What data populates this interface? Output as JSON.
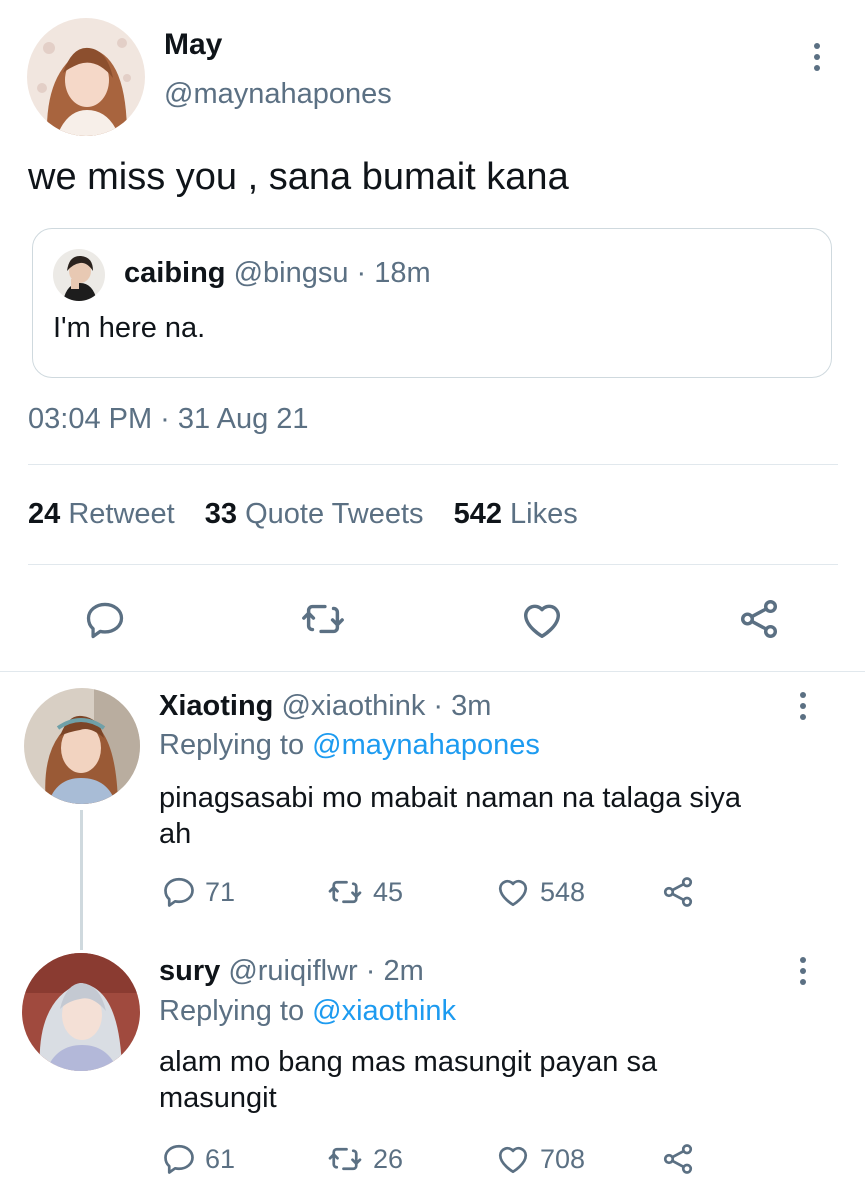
{
  "main_tweet": {
    "author_name": "May",
    "author_handle": "@maynahapones",
    "text": "we miss you , sana bumait kana",
    "quoted": {
      "author_name": "caibing",
      "meta": "@bingsu · 18m",
      "text": "I'm here na."
    },
    "timestamp": "03:04 PM · 31 Aug 21",
    "stats": {
      "retweets_count": "24",
      "retweets_label": "Retweet",
      "quotes_count": "33",
      "quotes_label": "Quote Tweets",
      "likes_count": "542",
      "likes_label": "Likes"
    },
    "icons": [
      "reply-icon",
      "retweet-icon",
      "like-icon",
      "share-icon"
    ]
  },
  "replies": [
    {
      "author_name": "Xiaoting",
      "meta": "@xiaothink · 3m",
      "replying_prefix": "Replying to",
      "replying_handle": "@maynahapones",
      "text_line1": "pinagsasabi mo mabait naman na talaga siya",
      "text_line2": "ah",
      "reply_count": "71",
      "retweet_count": "45",
      "like_count": "548"
    },
    {
      "author_name": "sury",
      "meta": "@ruiqiflwr · 2m",
      "replying_prefix": "Replying to",
      "replying_handle": "@xiaothink",
      "text_line1": "alam mo bang mas masungit payan sa",
      "text_line2": "masungit",
      "reply_count": "61",
      "retweet_count": "26",
      "like_count": "708"
    }
  ],
  "colors": {
    "text": "#0f1419",
    "secondary": "#5b7083",
    "link": "#1d9bf0",
    "divider": "#e1e8ed"
  }
}
